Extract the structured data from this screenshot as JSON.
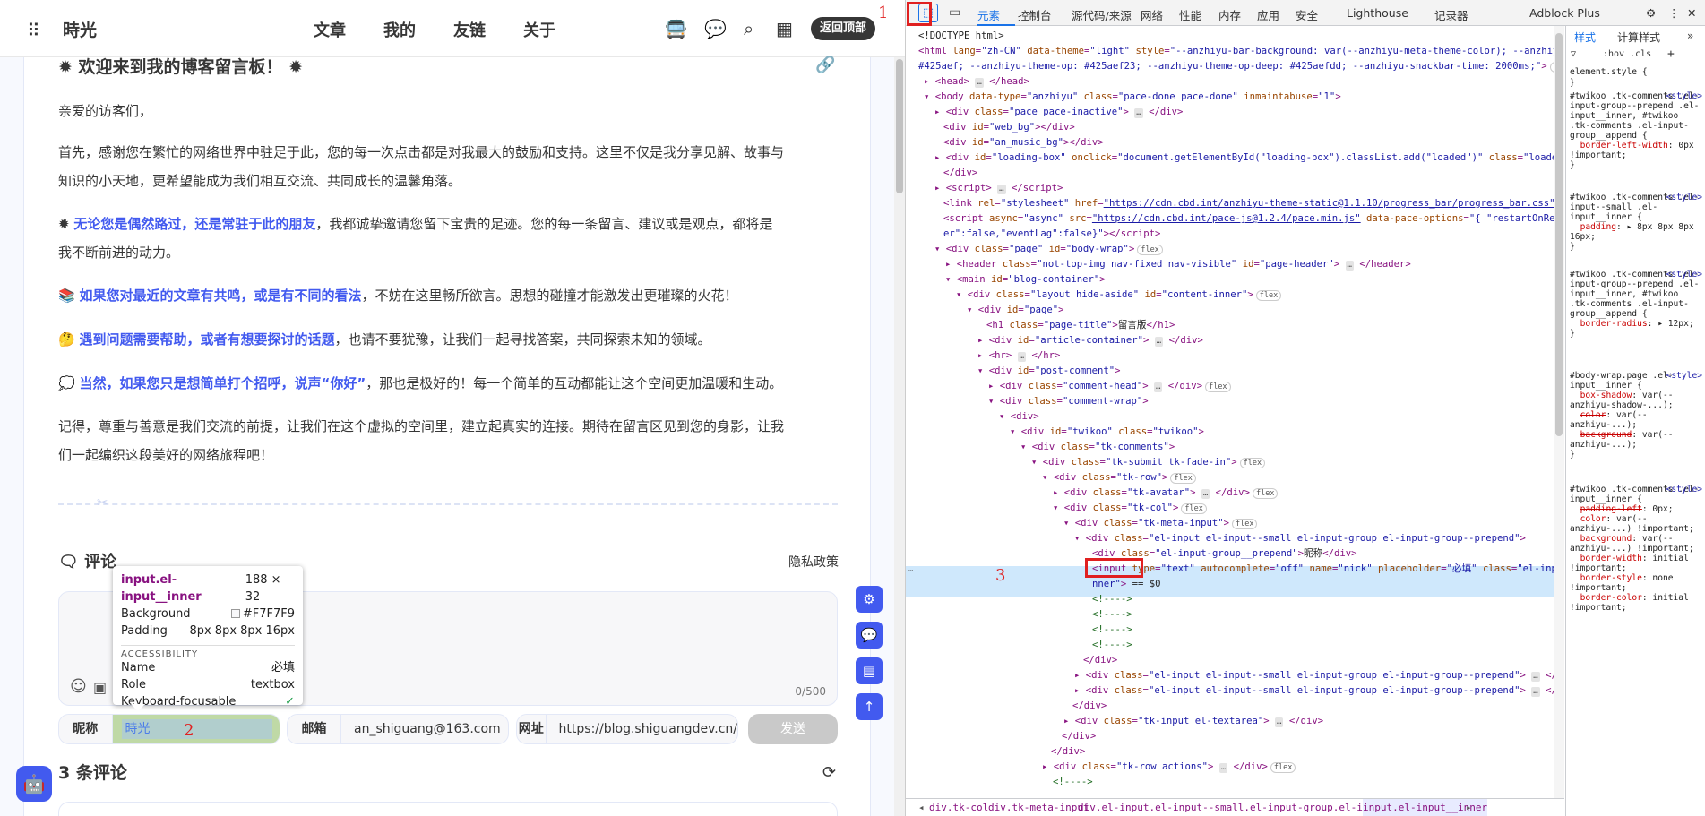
{
  "nav": {
    "site": "時光",
    "menu": [
      "文章",
      "我的",
      "友链",
      "关于"
    ],
    "back_top": "返回顶部"
  },
  "article": {
    "heading": "欢迎来到我的博客留言板！",
    "p1": "亲爱的访客们，",
    "p2a": "首先，感谢您在繁忙的网络世界中驻足于此，您的每一次点击都是对我最大的鼓励和支持。这里不仅是我分享见解、故事与",
    "p2b": "知识的小天地，更希望能成为我们相互交流、共同成长的温馨角落。",
    "p3_blue": "无论您是偶然路过，还是常驻于此的朋友",
    "p3a": "，我都诚挚邀请您留下宝贵的足迹。您的每一条留言、建议或是观点，都将是",
    "p3b": "我不断前进的动力。",
    "p4_blue": "如果您对最近的文章有共鸣，或是有不同的看法",
    "p4": "，不妨在这里畅所欲言。思想的碰撞才能激发出更璀璨的火花！",
    "p5_blue": "遇到问题需要帮助，或者有想要探讨的话题",
    "p5": "，也请不要犹豫，让我们一起寻找答案，共同探索未知的领域。",
    "p6_blue": "当然，如果您只是想简单打个招呼，说声“你好”",
    "p6": "，那也是极好的！每一个简单的互动都能让这个空间更加温暖和生动。",
    "p7a": "记得，尊重与善意是我们交流的前提，让我们在这个虚拟的空间里，建立起真实的连接。期待在留言区见到您的身影，让我",
    "p7b": "们一起编织这段美好的网络旅程吧！"
  },
  "comments": {
    "title": "评论",
    "privacy": "隐私政策",
    "counter": "0/500",
    "nick_label": "昵称",
    "nick_value": "時光",
    "mail_label": "邮箱",
    "mail_value": "an_shiguang@163.com",
    "url_label": "网址",
    "url_value": "https://blog.shiguangdev.cn/",
    "send": "发送",
    "count_text": "3 条评论"
  },
  "tooltip": {
    "selector": "input.el-input__inner",
    "size": "188 × 32",
    "bg_label": "Background",
    "bg_value": "#F7F7F9",
    "pad_label": "Padding",
    "pad_value": "8px 8px 8px 16px",
    "acc": "ACCESSIBILITY",
    "name_label": "Name",
    "name_value": "必填",
    "role_label": "Role",
    "role_value": "textbox",
    "kb_label": "Keyboard-focusable"
  },
  "markers": {
    "m1": "1",
    "m2": "2",
    "m3": "3"
  },
  "devtools": {
    "tabs": [
      "元素",
      "控制台",
      "源代码/来源",
      "网络",
      "性能",
      "内存",
      "应用",
      "安全",
      "Lighthouse",
      "记录器",
      "Adblock Plus"
    ],
    "styles_tabs": [
      "样式",
      "计算样式"
    ],
    "filter": ":hov .cls",
    "breadcrumb": [
      "div.tk-col",
      "div.tk-meta-input",
      "div.el-input.el-input--small.el-input-group.el-input-group--prepend",
      "input.el-input__inner"
    ]
  },
  "colors": {
    "accent": "#425aef",
    "highlight": "#e02020"
  }
}
